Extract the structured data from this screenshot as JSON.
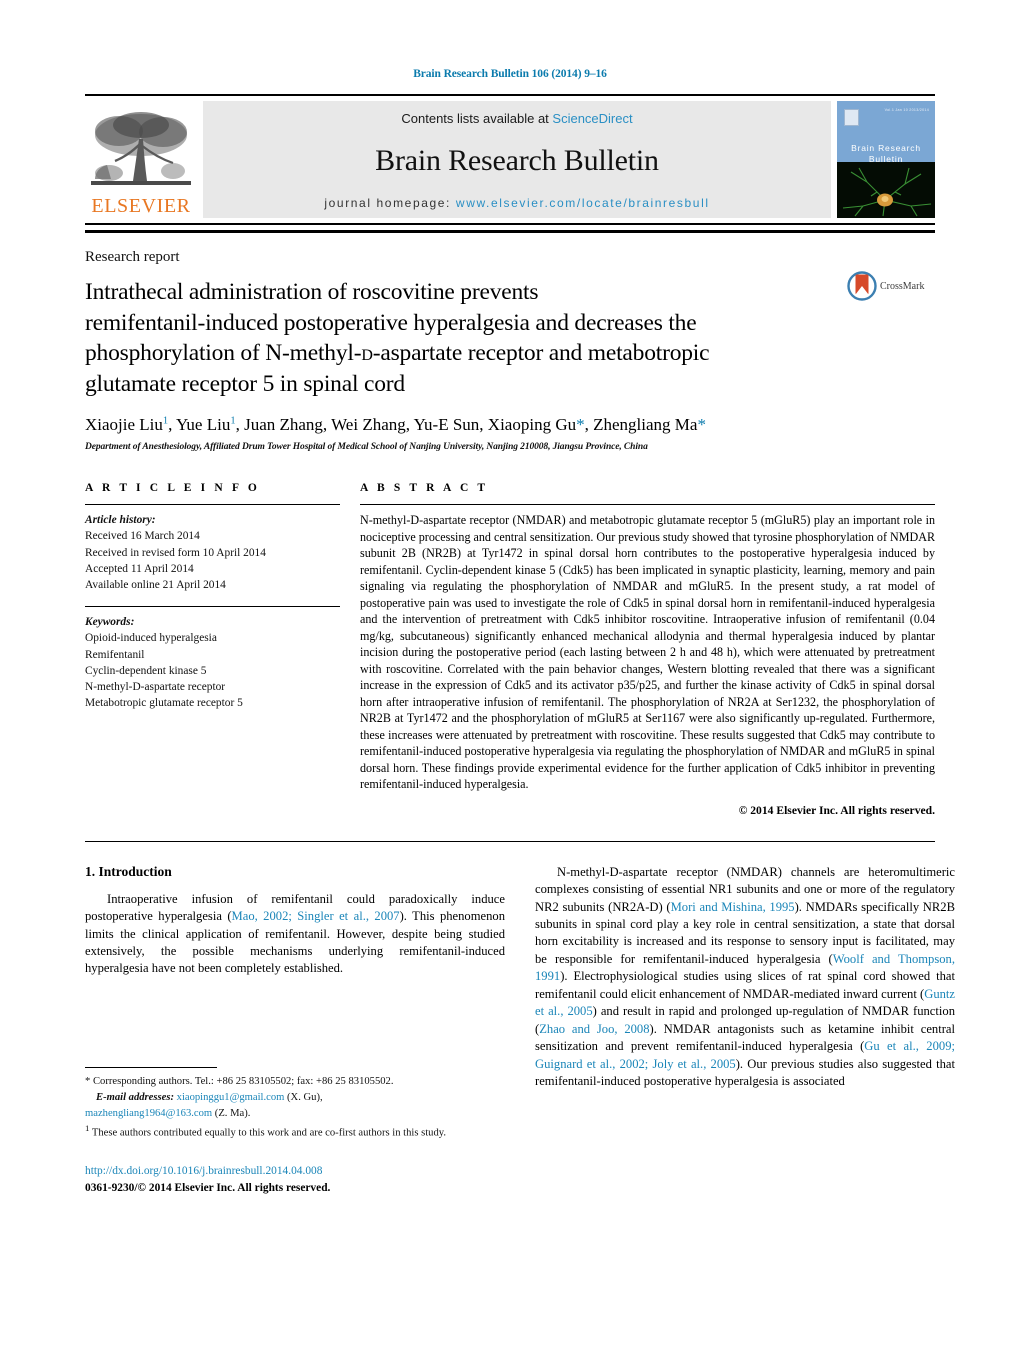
{
  "running_head": "Brain Research Bulletin 106 (2014) 9–16",
  "masthead": {
    "contents_prefix": "Contents lists available at ",
    "sciencedirect": "ScienceDirect",
    "journal_title": "Brain Research Bulletin",
    "homepage_prefix": "journal homepage:",
    "homepage_url": "www.elsevier.com/locate/brainresbull",
    "publisher_logo_text": "ELSEVIER",
    "cover_title_line1": "Brain Research",
    "cover_title_line2": "Bulletin",
    "cover_tinytext": "Vol.1   Jan 10   2013/2014"
  },
  "article": {
    "type": "Research report",
    "title": "Intrathecal administration of roscovitine prevents remifentanil-induced postoperative hyperalgesia and decreases the phosphorylation of N-methyl-D-aspartate receptor and metabotropic glutamate receptor 5 in spinal cord",
    "title_line1": "Intrathecal administration of roscovitine prevents",
    "title_line2": "remifentanil-induced postoperative hyperalgesia and decreases the",
    "title_line3a": "phosphorylation of N-methyl-",
    "title_line3b": "d",
    "title_line3c": "-aspartate receptor and metabotropic",
    "title_line4": "glutamate receptor 5 in spinal cord",
    "authors_text": "Xiaojie Liu¹, Yue Liu¹, Juan Zhang, Wei Zhang, Yu-E Sun, Xiaoping Gu*, Zhengliang Ma*",
    "affiliation": "Department of Anesthesiology, Affiliated Drum Tower Hospital of Medical School of Nanjing University, Nanjing 210008, Jiangsu Province, China",
    "crossmark_label": "CrossMark"
  },
  "article_info": {
    "heading": "A R T I C L E   I N F O",
    "history_title": "Article history:",
    "history": [
      "Received 16 March 2014",
      "Received in revised form 10 April 2014",
      "Accepted 11 April 2014",
      "Available online 21 April 2014"
    ],
    "keywords_title": "Keywords:",
    "keywords": [
      "Opioid-induced hyperalgesia",
      "Remifentanil",
      "Cyclin-dependent kinase 5",
      "N-methyl-D-aspartate receptor",
      "Metabotropic glutamate receptor 5"
    ]
  },
  "abstract": {
    "heading": "A B S T R A C T",
    "text": "N-methyl-D-aspartate receptor (NMDAR) and metabotropic glutamate receptor 5 (mGluR5) play an important role in nociceptive processing and central sensitization. Our previous study showed that tyrosine phosphorylation of NMDAR subunit 2B (NR2B) at Tyr1472 in spinal dorsal horn contributes to the postoperative hyperalgesia induced by remifentanil. Cyclin-dependent kinase 5 (Cdk5) has been implicated in synaptic plasticity, learning, memory and pain signaling via regulating the phosphorylation of NMDAR and mGluR5. In the present study, a rat model of postoperative pain was used to investigate the role of Cdk5 in spinal dorsal horn in remifentanil-induced hyperalgesia and the intervention of pretreatment with Cdk5 inhibitor roscovitine. Intraoperative infusion of remifentanil (0.04 mg/kg, subcutaneous) significantly enhanced mechanical allodynia and thermal hyperalgesia induced by plantar incision during the postoperative period (each lasting between 2 h and 48 h), which were attenuated by pretreatment with roscovitine. Correlated with the pain behavior changes, Western blotting revealed that there was a significant increase in the expression of Cdk5 and its activator p35/p25, and further the kinase activity of Cdk5 in spinal dorsal horn after intraoperative infusion of remifentanil. The phosphorylation of NR2A at Ser1232, the phosphorylation of NR2B at Tyr1472 and the phosphorylation of mGluR5 at Ser1167 were also significantly up-regulated. Furthermore, these increases were attenuated by pretreatment with roscovitine. These results suggested that Cdk5 may contribute to remifentanil-induced postoperative hyperalgesia via regulating the phosphorylation of NMDAR and mGluR5 in spinal dorsal horn. These findings provide experimental evidence for the further application of Cdk5 inhibitor in preventing remifentanil-induced hyperalgesia.",
    "copyright": "© 2014 Elsevier Inc. All rights reserved."
  },
  "body": {
    "section1_heading": "1.  Introduction",
    "left_para1_a": "Intraoperative infusion of remifentanil could paradoxically induce postoperative hyperalgesia (",
    "left_para1_cite": "Mao, 2002; Singler et al., 2007",
    "left_para1_b": "). This phenomenon limits the clinical application of remifentanil. However, despite being studied extensively, the possible mechanisms underlying remifentanil-induced hyperalgesia have not been completely established.",
    "right_p1_a": "N-methyl-D-aspartate receptor (NMDAR) channels are heteromultimeric complexes consisting of essential NR1 subunits and one or more of the regulatory NR2 subunits (NR2A-D) (",
    "right_p1_c1": "Mori and Mishina, 1995",
    "right_p1_b": "). NMDARs specifically NR2B subunits in spinal cord play a key role in central sensitization, a state that dorsal horn excitability is increased and its response to sensory input is facilitated, may be responsible for remifentanil-induced hyperalgesia (",
    "right_p1_c2": "Woolf and Thompson, 1991",
    "right_p1_d": "). Electrophysiological studies using slices of rat spinal cord showed that remifentanil could elicit enhancement of NMDAR-mediated inward current (",
    "right_p1_c3": "Guntz et al., 2005",
    "right_p1_e": ") and result in rapid and prolonged up-regulation of NMDAR function (",
    "right_p1_c4": "Zhao and Joo, 2008",
    "right_p1_f": "). NMDAR antagonists such as ketamine inhibit central sensitization and prevent remifentanil-induced hyperalgesia (",
    "right_p1_c5": "Gu et al., 2009; Guignard et al., 2002; Joly et al., 2005",
    "right_p1_g": "). Our previous studies also suggested that remifentanil-induced postoperative hyperalgesia is associated"
  },
  "footnotes": {
    "corresponding_marker": "*",
    "corresponding_text": "Corresponding authors. Tel.: +86 25 83105502; fax: +86 25 83105502.",
    "email_label": "E-mail addresses:",
    "email1": "xiaopinggu1@gmail.com",
    "email1_attr": "(X. Gu),",
    "email2": "mazhengliang1964@163.com",
    "email2_attr": "(Z. Ma).",
    "note1_marker": "1",
    "note1_text": "These authors contributed equally to this work and are co-first authors in this study.",
    "doi_url": "http://dx.doi.org/10.1016/j.brainresbull.2014.04.008",
    "issn_line": "0361-9230/© 2014 Elsevier Inc. All rights reserved."
  },
  "colors": {
    "header_teal": "#0b7bad",
    "link_blue": "#1a85b8",
    "sciencedirect_blue": "#2a8fc4",
    "elsevier_orange": "#e87722",
    "masthead_grey": "#e8e8e8",
    "cover_blue": "#7ba7d4"
  }
}
